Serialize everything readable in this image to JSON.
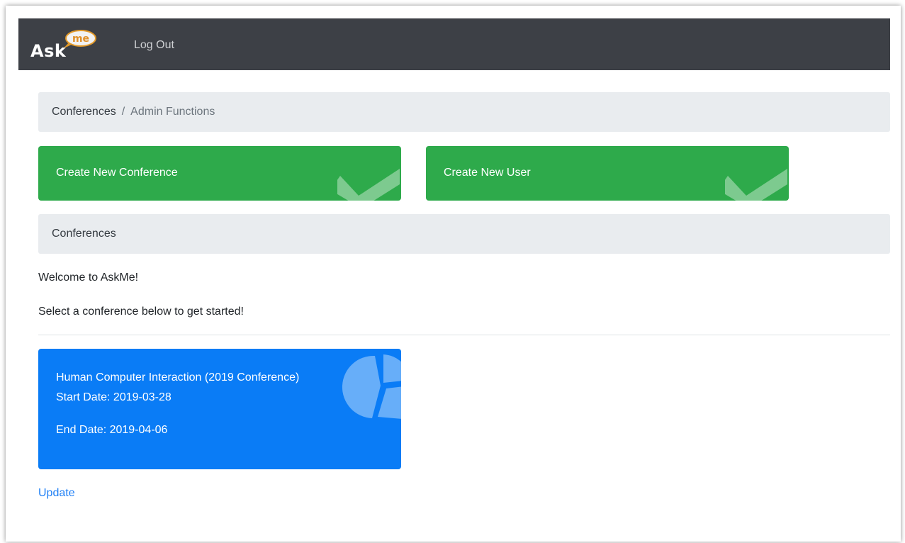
{
  "navbar": {
    "logo": {
      "ask_text": "Ask",
      "me_text": "me"
    },
    "logout_label": "Log Out"
  },
  "breadcrumb": {
    "items": [
      {
        "label": "Conferences"
      },
      {
        "label": "Admin Functions"
      }
    ],
    "separator": "/"
  },
  "actions": [
    {
      "label": "Create New Conference",
      "icon": "check-icon"
    },
    {
      "label": "Create New User",
      "icon": "check-icon"
    }
  ],
  "conferences_section": {
    "title": "Conferences",
    "welcome": "Welcome to AskMe!",
    "instruction": "Select a conference below to get started!"
  },
  "conference_cards": [
    {
      "name": "Human Computer Interaction (2019 Conference)",
      "start_date": "Start Date: 2019-03-28",
      "end_date": "End Date: 2019-04-06",
      "icon": "pie-chart-icon"
    }
  ],
  "update_label": "Update",
  "colors": {
    "navbar": "#3d4046",
    "success": "#2eaa4b",
    "primary": "#0a7cf6",
    "light": "#e9ecef",
    "link": "#1e7ff5",
    "logo_accent": "#f0a030"
  }
}
